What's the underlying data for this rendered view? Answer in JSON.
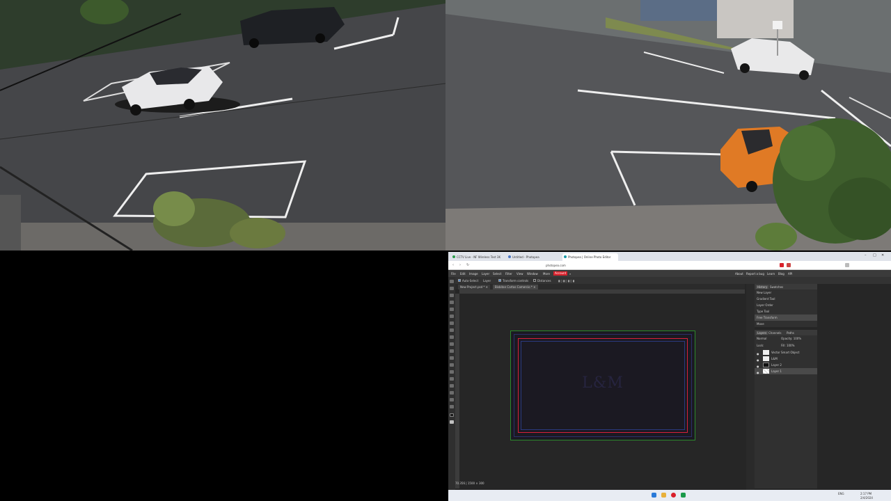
{
  "colors": {
    "accent_account": "#d9202b",
    "artboard_guide_green": "#2b8a2b",
    "artboard_guide_red": "#d9203a",
    "artboard_guide_blue": "#2a3a80"
  },
  "browser": {
    "tabs": [
      {
        "label": "CCTV Live - NF Wireless Test 3K",
        "icon": "camera-icon"
      },
      {
        "label": "Untitled - Photopea",
        "icon": "page-icon"
      },
      {
        "label": "Photopea | Online Photo Editor",
        "icon": "photopea-icon"
      }
    ],
    "url": "photopea.com",
    "window_controls": [
      "–",
      "□",
      "✕"
    ]
  },
  "photopea": {
    "menu": [
      "File",
      "Edit",
      "Image",
      "Layer",
      "Select",
      "Filter",
      "View",
      "Window",
      "More"
    ],
    "account_label": "Account",
    "right_menu": [
      "About",
      "Report a bug",
      "Learn",
      "Blog",
      "API"
    ],
    "options": {
      "auto_select": "Auto-Select",
      "layer_select": "Layer",
      "transform_controls": "Transform controls",
      "distances": "Distances"
    },
    "doc_tabs": [
      {
        "label": "New Project.psd *",
        "close": "✕"
      },
      {
        "label": "Bisbitan Cartas Comercio *",
        "close": "✕"
      }
    ],
    "artboard_text": "L&M",
    "status": "70.356 | 1500 × 300",
    "history_panel": {
      "tabs": [
        "History",
        "Swatches"
      ],
      "items": [
        "New Layer",
        "Gradient Tool",
        "Layer Order",
        "Type Tool",
        "Free Transform",
        "Move"
      ]
    },
    "layers_panel": {
      "tabs": [
        "Layers",
        "Channels",
        "Paths"
      ],
      "blend_mode": "Normal",
      "opacity_label": "Opacity: 100%",
      "lock_label": "Lock:",
      "fill_label": "Fill: 100%",
      "layers": [
        {
          "name": "Vector Smart Object",
          "thumb": "light"
        },
        {
          "name": "L&M",
          "thumb": "light"
        },
        {
          "name": "Layer 2",
          "thumb": "dark"
        },
        {
          "name": "Layer 1",
          "thumb": "check"
        }
      ]
    }
  },
  "taskbar": {
    "tray_time": "2:17 PM",
    "tray_date": "2/4/2024",
    "tray_lang": "ENG"
  }
}
